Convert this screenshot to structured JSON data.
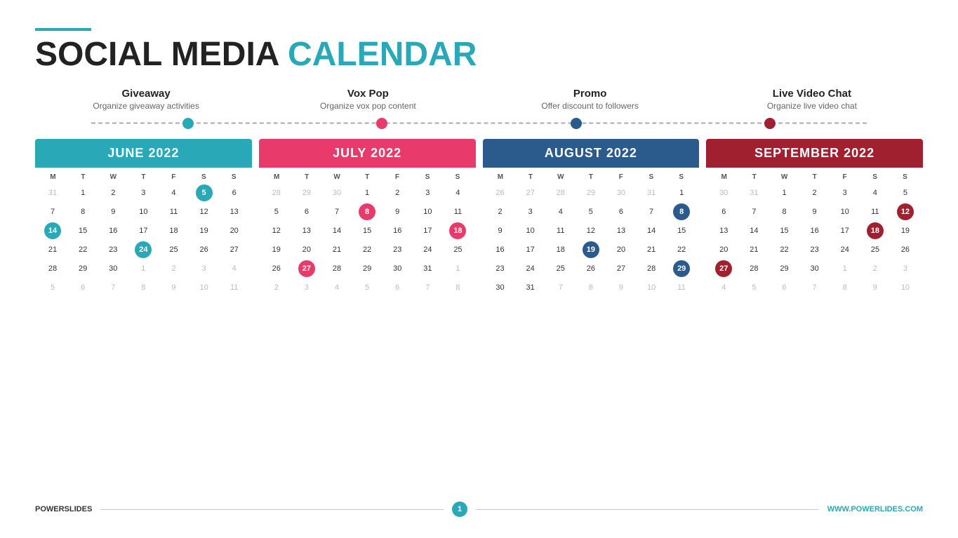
{
  "header": {
    "line_color": "#29a8b8",
    "title_plain": "SOCIAL MEDIA ",
    "title_highlight": "CALENDAR"
  },
  "categories": [
    {
      "id": "giveaway",
      "title": "Giveaway",
      "subtitle": "Organize giveaway activities",
      "dot_class": "dot-teal"
    },
    {
      "id": "vox-pop",
      "title": "Vox Pop",
      "subtitle": "Organize vox pop content",
      "dot_class": "dot-red"
    },
    {
      "id": "promo",
      "title": "Promo",
      "subtitle": "Offer discount to followers",
      "dot_class": "dot-dark"
    },
    {
      "id": "live-video",
      "title": "Live Video Chat",
      "subtitle": "Organize live video chat",
      "dot_class": "dot-darkred"
    }
  ],
  "footer": {
    "brand": "POWERSLIDES",
    "page_number": "1",
    "website": "WWW.POWERLIDES.COM"
  },
  "calendars": [
    {
      "id": "june-2022",
      "month": "JUNE 2022",
      "theme": "cal-teal",
      "weekdays": [
        "M",
        "T",
        "W",
        "T",
        "F",
        "S",
        "S"
      ],
      "weeks": [
        [
          {
            "d": "31",
            "m": "o"
          },
          {
            "d": "1"
          },
          {
            "d": "2"
          },
          {
            "d": "3"
          },
          {
            "d": "4"
          },
          {
            "d": "5",
            "h": "teal"
          },
          {
            "d": "6"
          }
        ],
        [
          {
            "d": "7"
          },
          {
            "d": "8"
          },
          {
            "d": "9"
          },
          {
            "d": "10"
          },
          {
            "d": "11"
          },
          {
            "d": "12"
          },
          {
            "d": "13"
          }
        ],
        [
          {
            "d": "14",
            "h": "teal"
          },
          {
            "d": "15"
          },
          {
            "d": "16"
          },
          {
            "d": "17"
          },
          {
            "d": "18"
          },
          {
            "d": "19"
          },
          {
            "d": "20"
          }
        ],
        [
          {
            "d": "21"
          },
          {
            "d": "22"
          },
          {
            "d": "23"
          },
          {
            "d": "24",
            "h": "teal"
          },
          {
            "d": "25"
          },
          {
            "d": "26"
          },
          {
            "d": "27"
          }
        ],
        [
          {
            "d": "28"
          },
          {
            "d": "29"
          },
          {
            "d": "30"
          },
          {
            "d": "1",
            "m": "o"
          },
          {
            "d": "2",
            "m": "o"
          },
          {
            "d": "3",
            "m": "o"
          },
          {
            "d": "4",
            "m": "o"
          }
        ],
        [
          {
            "d": "5",
            "m": "o"
          },
          {
            "d": "6",
            "m": "o"
          },
          {
            "d": "7",
            "m": "o"
          },
          {
            "d": "8",
            "m": "o"
          },
          {
            "d": "9",
            "m": "o"
          },
          {
            "d": "10",
            "m": "o"
          },
          {
            "d": "11",
            "m": "o"
          }
        ]
      ]
    },
    {
      "id": "july-2022",
      "month": "JULY 2022",
      "theme": "cal-red",
      "weekdays": [
        "M",
        "T",
        "W",
        "T",
        "F",
        "S",
        "S"
      ],
      "weeks": [
        [
          {
            "d": "28",
            "m": "o"
          },
          {
            "d": "29",
            "m": "o"
          },
          {
            "d": "30",
            "m": "o"
          },
          {
            "d": "1"
          },
          {
            "d": "2"
          },
          {
            "d": "3"
          },
          {
            "d": "4"
          }
        ],
        [
          {
            "d": "5"
          },
          {
            "d": "6"
          },
          {
            "d": "7"
          },
          {
            "d": "8",
            "h": "red"
          },
          {
            "d": "9"
          },
          {
            "d": "10"
          },
          {
            "d": "11"
          }
        ],
        [
          {
            "d": "12"
          },
          {
            "d": "13"
          },
          {
            "d": "14"
          },
          {
            "d": "15"
          },
          {
            "d": "16"
          },
          {
            "d": "17"
          },
          {
            "d": "18",
            "h": "red"
          }
        ],
        [
          {
            "d": "19"
          },
          {
            "d": "20"
          },
          {
            "d": "21"
          },
          {
            "d": "22"
          },
          {
            "d": "23"
          },
          {
            "d": "24"
          },
          {
            "d": "25"
          }
        ],
        [
          {
            "d": "26"
          },
          {
            "d": "27",
            "h": "red"
          },
          {
            "d": "28"
          },
          {
            "d": "29"
          },
          {
            "d": "30"
          },
          {
            "d": "31"
          },
          {
            "d": "1",
            "m": "o"
          }
        ],
        [
          {
            "d": "2",
            "m": "o"
          },
          {
            "d": "3",
            "m": "o"
          },
          {
            "d": "4",
            "m": "o"
          },
          {
            "d": "5",
            "m": "o"
          },
          {
            "d": "6",
            "m": "o"
          },
          {
            "d": "7",
            "m": "o"
          },
          {
            "d": "8",
            "m": "o"
          }
        ]
      ]
    },
    {
      "id": "august-2022",
      "month": "AUGUST 2022",
      "theme": "cal-dark",
      "weekdays": [
        "M",
        "T",
        "W",
        "T",
        "F",
        "S",
        "S"
      ],
      "weeks": [
        [
          {
            "d": "26",
            "m": "o"
          },
          {
            "d": "27",
            "m": "o"
          },
          {
            "d": "28",
            "m": "o"
          },
          {
            "d": "29",
            "m": "o"
          },
          {
            "d": "30",
            "m": "o"
          },
          {
            "d": "31",
            "m": "o"
          },
          {
            "d": "1"
          }
        ],
        [
          {
            "d": "2"
          },
          {
            "d": "3"
          },
          {
            "d": "4"
          },
          {
            "d": "5"
          },
          {
            "d": "6"
          },
          {
            "d": "7"
          },
          {
            "d": "8",
            "h": "dark"
          }
        ],
        [
          {
            "d": "9"
          },
          {
            "d": "10"
          },
          {
            "d": "11"
          },
          {
            "d": "12"
          },
          {
            "d": "13"
          },
          {
            "d": "14"
          },
          {
            "d": "15"
          }
        ],
        [
          {
            "d": "16"
          },
          {
            "d": "17"
          },
          {
            "d": "18"
          },
          {
            "d": "19",
            "h": "dark"
          },
          {
            "d": "20"
          },
          {
            "d": "21"
          },
          {
            "d": "22"
          }
        ],
        [
          {
            "d": "23"
          },
          {
            "d": "24"
          },
          {
            "d": "25"
          },
          {
            "d": "26"
          },
          {
            "d": "27"
          },
          {
            "d": "28"
          },
          {
            "d": "29",
            "h": "dark"
          }
        ],
        [
          {
            "d": "30"
          },
          {
            "d": "31"
          },
          {
            "d": "7",
            "m": "o"
          },
          {
            "d": "8",
            "m": "o"
          },
          {
            "d": "9",
            "m": "o"
          },
          {
            "d": "10",
            "m": "o"
          },
          {
            "d": "11",
            "m": "o"
          }
        ]
      ]
    },
    {
      "id": "september-2022",
      "month": "SEPTEMBER 2022",
      "theme": "cal-darkred",
      "weekdays": [
        "M",
        "T",
        "W",
        "T",
        "F",
        "S",
        "S"
      ],
      "weeks": [
        [
          {
            "d": "30",
            "m": "o"
          },
          {
            "d": "31",
            "m": "o"
          },
          {
            "d": "1"
          },
          {
            "d": "2"
          },
          {
            "d": "3"
          },
          {
            "d": "4"
          },
          {
            "d": "5"
          }
        ],
        [
          {
            "d": "6"
          },
          {
            "d": "7"
          },
          {
            "d": "8"
          },
          {
            "d": "9"
          },
          {
            "d": "10"
          },
          {
            "d": "11"
          },
          {
            "d": "12",
            "h": "darkred"
          }
        ],
        [
          {
            "d": "13"
          },
          {
            "d": "14"
          },
          {
            "d": "15"
          },
          {
            "d": "16"
          },
          {
            "d": "17"
          },
          {
            "d": "18",
            "h": "darkred"
          },
          {
            "d": "19"
          }
        ],
        [
          {
            "d": "20"
          },
          {
            "d": "21"
          },
          {
            "d": "22"
          },
          {
            "d": "23"
          },
          {
            "d": "24"
          },
          {
            "d": "25"
          },
          {
            "d": "26"
          }
        ],
        [
          {
            "d": "27",
            "h": "darkred"
          },
          {
            "d": "28"
          },
          {
            "d": "29"
          },
          {
            "d": "30"
          },
          {
            "d": "1",
            "m": "o"
          },
          {
            "d": "2",
            "m": "o"
          },
          {
            "d": "3",
            "m": "o"
          }
        ],
        [
          {
            "d": "4",
            "m": "o"
          },
          {
            "d": "5",
            "m": "o"
          },
          {
            "d": "6",
            "m": "o"
          },
          {
            "d": "7",
            "m": "o"
          },
          {
            "d": "8",
            "m": "o"
          },
          {
            "d": "9",
            "m": "o"
          },
          {
            "d": "10",
            "m": "o"
          }
        ]
      ]
    }
  ]
}
